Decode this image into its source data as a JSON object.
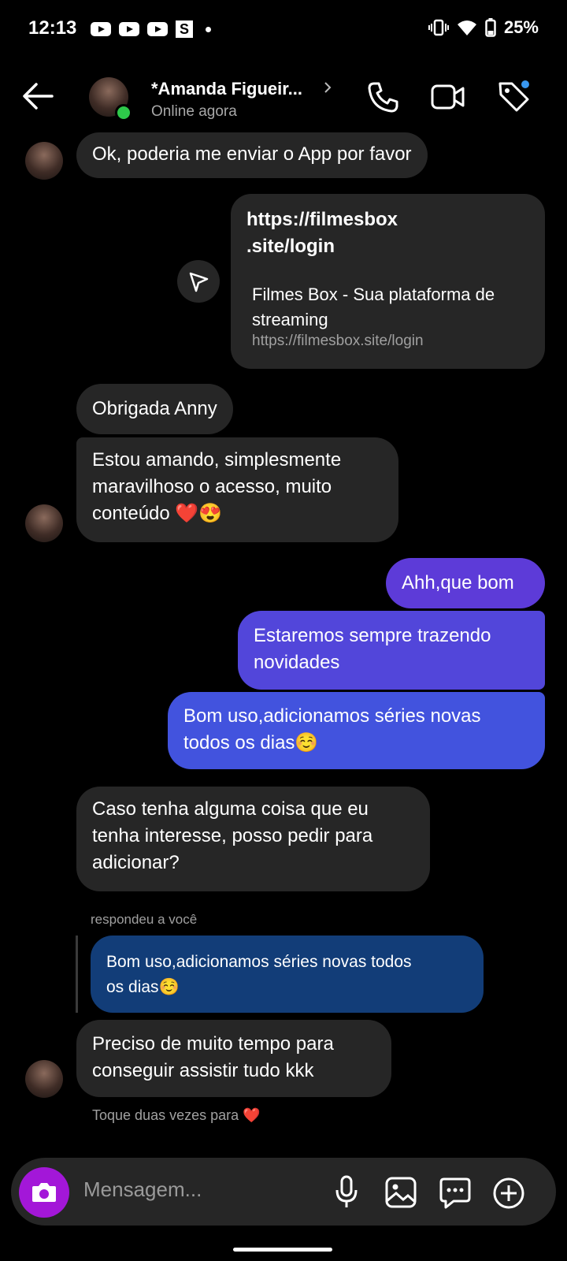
{
  "status_bar": {
    "time": "12:13",
    "battery": "25%"
  },
  "header": {
    "name": "*Amanda Figueir...",
    "status": "Online agora"
  },
  "messages": {
    "m1": "Ok, poderia me enviar o App por favor",
    "link_url_line1": "https://filmesbox",
    "link_url_line2": ".site/login",
    "link_title_line1": "Filmes Box - Sua plataforma de",
    "link_title_line2": "streaming",
    "link_domain": "https://filmesbox.site/login",
    "m2": "Obrigada Anny",
    "m3_line1": "Estou amando, simplesmente",
    "m3_line2": "maravilhoso o acesso, muito",
    "m3_line3": "conteúdo ❤️😍",
    "m4": "Ahh,que bom",
    "m5_line1": "Estaremos sempre trazendo",
    "m5_line2": "novidades",
    "m6_line1": "Bom uso,adicionamos séries novas",
    "m6_line2": "todos os dias☺️",
    "m7_line1": "Caso tenha alguma coisa que eu",
    "m7_line2": "tenha interesse, posso pedir para",
    "m7_line3": "adicionar?",
    "reply_label": "respondeu a você",
    "quoted_line1": "Bom uso,adicionamos séries novas todos",
    "quoted_line2": "os dias☺️",
    "m8_line1": "Preciso de muito tempo para",
    "m8_line2": "conseguir assistir tudo kkk",
    "hint": "Toque duas vezes para ❤️"
  },
  "composer": {
    "placeholder": "Mensagem..."
  },
  "colors": {
    "incoming_bubble": "#262626",
    "outgoing_top": "#5e3bd6",
    "outgoing_bottom": "#3e56e0",
    "quoted_bubble": "#123d78",
    "camera_button": "#a317d8",
    "online": "#2ec84a",
    "tag_badge": "#3897f0"
  },
  "icons": {
    "back": "arrow-left-icon",
    "call": "phone-icon",
    "video": "video-camera-icon",
    "tag": "tag-icon",
    "share": "send-icon",
    "mic": "microphone-icon",
    "gallery": "image-icon",
    "sticker": "chat-bubble-icon",
    "add": "plus-circle-icon",
    "camera": "camera-icon"
  }
}
